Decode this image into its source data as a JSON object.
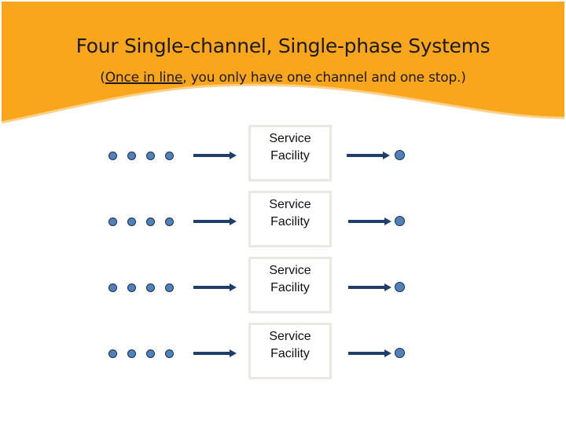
{
  "slide": {
    "title": "Four Single-channel, Single-phase Systems",
    "subtitle_underlined": "Once in line",
    "subtitle_open_paren": "(",
    "subtitle_rest": ", you only have one channel and one stop.)",
    "colors": {
      "banner": "#f9a61c",
      "dot_fill": "#4f81bd",
      "arrow": "#1f3f6a",
      "facility_border": "#eae8e0"
    }
  },
  "systems": [
    {
      "queue_count": 4,
      "facility_line1": "Service",
      "facility_line2": "Facility",
      "exit_count": 1
    },
    {
      "queue_count": 4,
      "facility_line1": "Service",
      "facility_line2": "Facility",
      "exit_count": 1
    },
    {
      "queue_count": 4,
      "facility_line1": "Service",
      "facility_line2": "Facility",
      "exit_count": 1
    },
    {
      "queue_count": 4,
      "facility_line1": "Service",
      "facility_line2": "Facility",
      "exit_count": 1
    }
  ]
}
